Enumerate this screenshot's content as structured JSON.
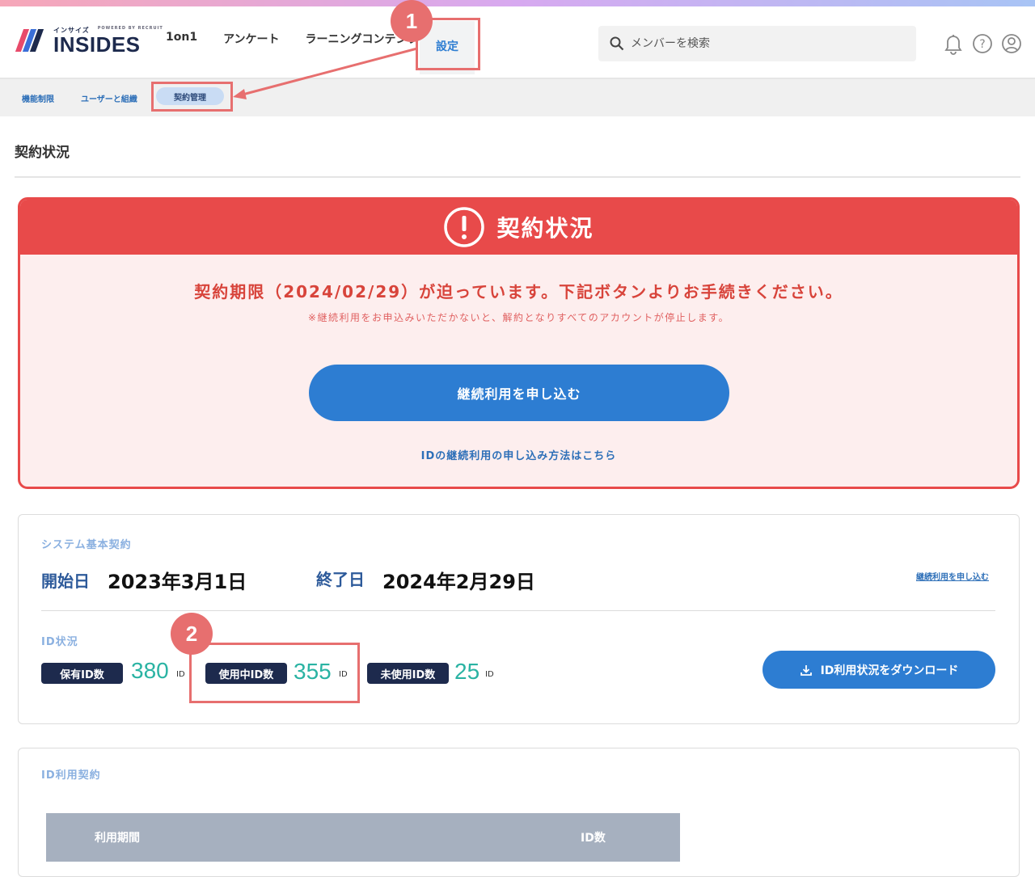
{
  "app": {
    "logo_sub": "インサイズ",
    "logo_by": "POWERED BY RECRUIT",
    "logo_main": "INSIDES"
  },
  "nav": {
    "items": [
      "1on1",
      "アンケート",
      "ラーニングコンテンツ"
    ],
    "active": "設定"
  },
  "search": {
    "placeholder": "メンバーを検索"
  },
  "header_icons": [
    "bell-icon",
    "help-icon",
    "user-icon"
  ],
  "subnav": {
    "items": [
      "機能制限",
      "ユーザーと組織"
    ],
    "active": "契約管理"
  },
  "page": {
    "title": "契約状況"
  },
  "alert": {
    "title": "契約状況",
    "message": "契約期限（2024/02/29）が迫っています。下記ボタンよりお手続きください。",
    "note": "※継続利用をお申込みいただかないと、解約となりすべてのアカウントが停止します。",
    "cta": "継続利用を申し込む",
    "link": "IDの継続利用の申し込み方法はこちら"
  },
  "contract": {
    "label": "システム基本契約",
    "start_label": "開始日",
    "start_value": "2023年3月1日",
    "end_label": "終了日",
    "end_value": "2024年2月29日",
    "renew_link": "継続利用を申し込む"
  },
  "id_status": {
    "label": "ID状況",
    "owned_label": "保有ID数",
    "owned_value": "380",
    "used_label": "使用中ID数",
    "used_value": "355",
    "unused_label": "未使用ID数",
    "unused_value": "25",
    "unit": "ID",
    "download": "ID利用状況をダウンロード"
  },
  "id_contract": {
    "label": "ID利用契約",
    "col_period": "利用期間",
    "col_count": "ID数"
  },
  "annotations": {
    "one": "1",
    "two": "2"
  },
  "colors": {
    "accent": "#2d7dd2",
    "alert": "#e84a4a",
    "navy": "#1d2a4d",
    "teal": "#2ab3a3",
    "annotation": "#e76f6f"
  }
}
